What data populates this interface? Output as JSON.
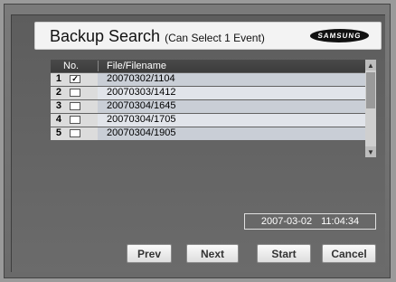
{
  "dialog": {
    "title": "Backup Search",
    "subtitle": "(Can Select 1 Event)",
    "brand": "SAMSUNG"
  },
  "table": {
    "headers": [
      "No.",
      "File/Filename"
    ],
    "rows": [
      {
        "no": "1",
        "checked": true,
        "checkbox": "✓",
        "filename": "20070302/1104"
      },
      {
        "no": "2",
        "checked": false,
        "checkbox": "",
        "filename": "20070303/1412"
      },
      {
        "no": "3",
        "checked": false,
        "checkbox": "",
        "filename": "20070304/1645"
      },
      {
        "no": "4",
        "checked": false,
        "checkbox": "",
        "filename": "20070304/1705"
      },
      {
        "no": "5",
        "checked": false,
        "checkbox": "",
        "filename": "20070304/1905"
      }
    ]
  },
  "datetime": {
    "date": "2007-03-02",
    "time": "11:04:34"
  },
  "buttons": {
    "prev": "Prev",
    "next": "Next",
    "start": "Start",
    "cancel": "Cancel"
  },
  "icons": {
    "scroll_up": "triangle-up-icon",
    "scroll_down": "triangle-down-icon"
  }
}
